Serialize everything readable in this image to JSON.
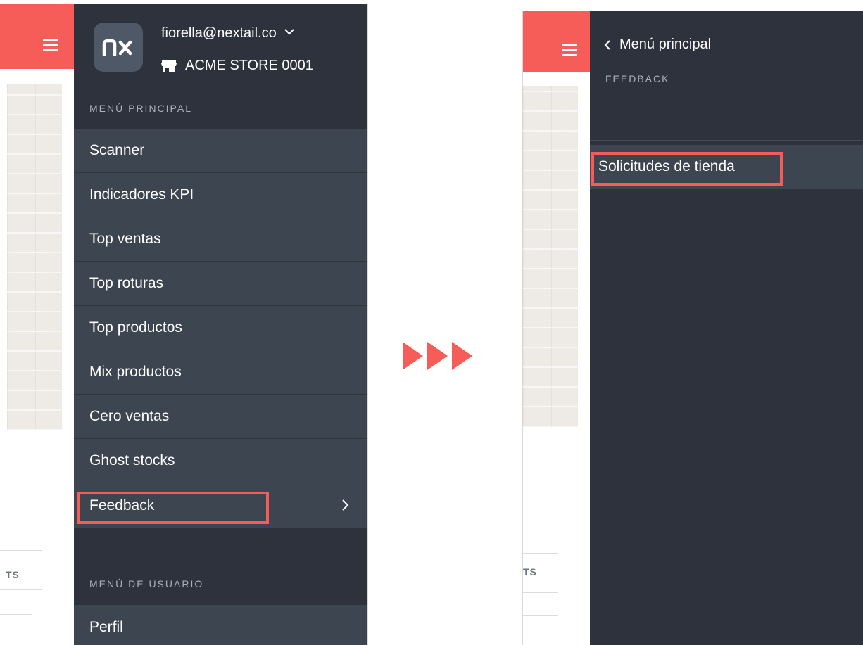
{
  "colors": {
    "accent": "#f65c58",
    "drawer_bg": "#2e323d",
    "menu_item_bg": "#3c4550",
    "logo_bg": "#4f5866"
  },
  "left": {
    "user": {
      "email": "fiorella@nextail.co",
      "store": "ACME STORE 0001",
      "logo_text": "nx"
    },
    "main_menu_label": "MENÚ PRINCIPAL",
    "main_menu_items": [
      {
        "label": "Scanner"
      },
      {
        "label": "Indicadores KPI"
      },
      {
        "label": "Top ventas"
      },
      {
        "label": "Top roturas"
      },
      {
        "label": "Top productos"
      },
      {
        "label": "Mix productos"
      },
      {
        "label": "Cero ventas"
      },
      {
        "label": "Ghost stocks"
      },
      {
        "label": "Feedback"
      }
    ],
    "user_menu_label": "MENÚ DE USUARIO",
    "user_menu_items": [
      {
        "label": "Perfil"
      }
    ],
    "background_tab_fragment": "TS"
  },
  "right": {
    "back_label": "Menú principal",
    "section_label": "FEEDBACK",
    "items": [
      {
        "label": "Solicitudes de tienda"
      }
    ],
    "background_tab_fragment": "TS"
  },
  "icons": {
    "hamburger": "hamburger-menu-icon",
    "account_dropdown": "chevron-down-icon",
    "store": "store-icon",
    "submenu": "chevron-right-icon",
    "back": "chevron-left-icon",
    "transition": "triple-arrow-icon"
  }
}
